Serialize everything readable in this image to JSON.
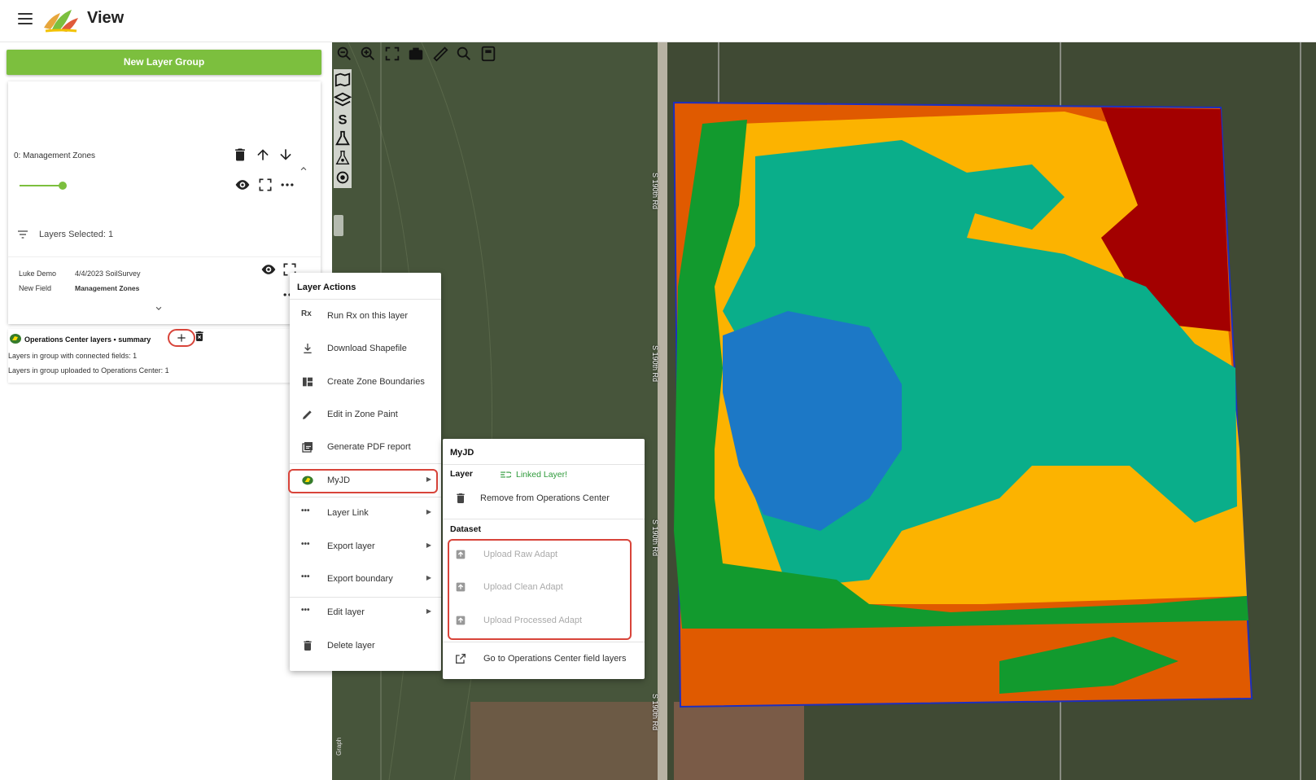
{
  "app": {
    "title": "View"
  },
  "left_panel": {
    "new_group_label": "New Layer Group",
    "group": {
      "name": "0: Management Zones",
      "layers_selected": "Layers Selected: 1",
      "layer": {
        "col1_line1": "Luke Demo",
        "col1_line2": "New Field",
        "col2_line1": "4/4/2023 SoilSurvey",
        "col2_line2": "Management Zones"
      }
    },
    "operations_center": {
      "title": "Operations Center layers • summary",
      "line1": "Layers in group with connected fields: 1",
      "line2": "Layers in group uploaded to Operations Center: 1"
    }
  },
  "map": {
    "road_labels": [
      "S 190th Rd",
      "S 190th Rd",
      "S 190th Rd",
      "S 190th Rd"
    ],
    "attribution": "Graph"
  },
  "layer_actions_menu": {
    "title": "Layer Actions",
    "items": [
      {
        "icon": "Rx",
        "label": "Run Rx on this layer"
      },
      {
        "icon": "download-icon",
        "label": "Download Shapefile"
      },
      {
        "icon": "zone-boundaries-icon",
        "label": "Create Zone Boundaries"
      },
      {
        "icon": "pencil-icon",
        "label": "Edit in Zone Paint"
      },
      {
        "icon": "pdf-icon",
        "label": "Generate PDF report"
      },
      {
        "icon": "john-deere-icon",
        "label": "MyJD"
      },
      {
        "icon": "more-icon",
        "label": "Layer Link"
      },
      {
        "icon": "more-icon",
        "label": "Export layer"
      },
      {
        "icon": "more-icon",
        "label": "Export boundary"
      },
      {
        "icon": "more-icon",
        "label": "Edit layer"
      },
      {
        "icon": "trash-icon",
        "label": "Delete layer"
      }
    ]
  },
  "myjd_menu": {
    "title": "MyJD",
    "layer_heading": "Layer",
    "linked_status": "Linked Layer!",
    "remove_label": "Remove from Operations Center",
    "dataset_heading": "Dataset",
    "upload_raw": "Upload Raw Adapt",
    "upload_clean": "Upload Clean Adapt",
    "upload_processed": "Upload Processed Adapt",
    "goto_label": "Go to Operations Center field layers"
  },
  "colors": {
    "accent_green": "#7cbf3e",
    "highlight_red": "#d8443a",
    "linked_green": "#2e9a3a",
    "zone_orange": "#e05a00",
    "zone_yellow": "#fcb300",
    "zone_teal": "#0aae8a",
    "zone_blue": "#1c78c6",
    "zone_green": "#129a2e",
    "zone_red": "#a30000"
  }
}
